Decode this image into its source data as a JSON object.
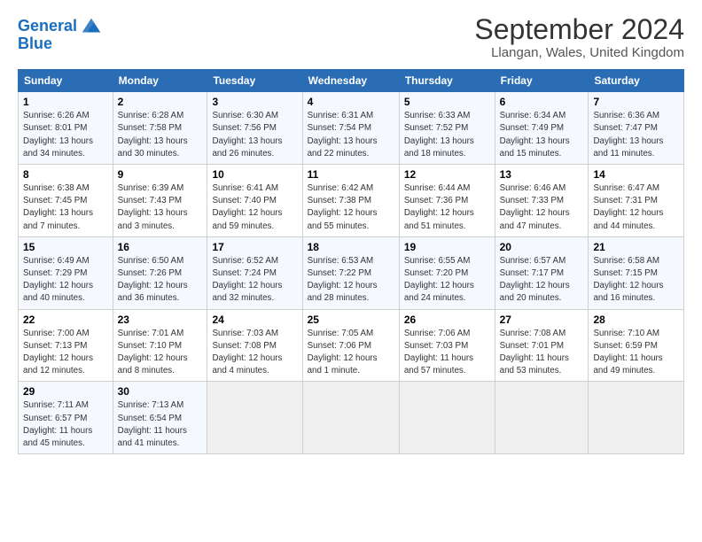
{
  "header": {
    "logo_line1": "General",
    "logo_line2": "Blue",
    "title": "September 2024",
    "subtitle": "Llangan, Wales, United Kingdom"
  },
  "columns": [
    "Sunday",
    "Monday",
    "Tuesday",
    "Wednesday",
    "Thursday",
    "Friday",
    "Saturday"
  ],
  "rows": [
    [
      {
        "day": "1",
        "lines": [
          "Sunrise: 6:26 AM",
          "Sunset: 8:01 PM",
          "Daylight: 13 hours",
          "and 34 minutes."
        ]
      },
      {
        "day": "2",
        "lines": [
          "Sunrise: 6:28 AM",
          "Sunset: 7:58 PM",
          "Daylight: 13 hours",
          "and 30 minutes."
        ]
      },
      {
        "day": "3",
        "lines": [
          "Sunrise: 6:30 AM",
          "Sunset: 7:56 PM",
          "Daylight: 13 hours",
          "and 26 minutes."
        ]
      },
      {
        "day": "4",
        "lines": [
          "Sunrise: 6:31 AM",
          "Sunset: 7:54 PM",
          "Daylight: 13 hours",
          "and 22 minutes."
        ]
      },
      {
        "day": "5",
        "lines": [
          "Sunrise: 6:33 AM",
          "Sunset: 7:52 PM",
          "Daylight: 13 hours",
          "and 18 minutes."
        ]
      },
      {
        "day": "6",
        "lines": [
          "Sunrise: 6:34 AM",
          "Sunset: 7:49 PM",
          "Daylight: 13 hours",
          "and 15 minutes."
        ]
      },
      {
        "day": "7",
        "lines": [
          "Sunrise: 6:36 AM",
          "Sunset: 7:47 PM",
          "Daylight: 13 hours",
          "and 11 minutes."
        ]
      }
    ],
    [
      {
        "day": "8",
        "lines": [
          "Sunrise: 6:38 AM",
          "Sunset: 7:45 PM",
          "Daylight: 13 hours",
          "and 7 minutes."
        ]
      },
      {
        "day": "9",
        "lines": [
          "Sunrise: 6:39 AM",
          "Sunset: 7:43 PM",
          "Daylight: 13 hours",
          "and 3 minutes."
        ]
      },
      {
        "day": "10",
        "lines": [
          "Sunrise: 6:41 AM",
          "Sunset: 7:40 PM",
          "Daylight: 12 hours",
          "and 59 minutes."
        ]
      },
      {
        "day": "11",
        "lines": [
          "Sunrise: 6:42 AM",
          "Sunset: 7:38 PM",
          "Daylight: 12 hours",
          "and 55 minutes."
        ]
      },
      {
        "day": "12",
        "lines": [
          "Sunrise: 6:44 AM",
          "Sunset: 7:36 PM",
          "Daylight: 12 hours",
          "and 51 minutes."
        ]
      },
      {
        "day": "13",
        "lines": [
          "Sunrise: 6:46 AM",
          "Sunset: 7:33 PM",
          "Daylight: 12 hours",
          "and 47 minutes."
        ]
      },
      {
        "day": "14",
        "lines": [
          "Sunrise: 6:47 AM",
          "Sunset: 7:31 PM",
          "Daylight: 12 hours",
          "and 44 minutes."
        ]
      }
    ],
    [
      {
        "day": "15",
        "lines": [
          "Sunrise: 6:49 AM",
          "Sunset: 7:29 PM",
          "Daylight: 12 hours",
          "and 40 minutes."
        ]
      },
      {
        "day": "16",
        "lines": [
          "Sunrise: 6:50 AM",
          "Sunset: 7:26 PM",
          "Daylight: 12 hours",
          "and 36 minutes."
        ]
      },
      {
        "day": "17",
        "lines": [
          "Sunrise: 6:52 AM",
          "Sunset: 7:24 PM",
          "Daylight: 12 hours",
          "and 32 minutes."
        ]
      },
      {
        "day": "18",
        "lines": [
          "Sunrise: 6:53 AM",
          "Sunset: 7:22 PM",
          "Daylight: 12 hours",
          "and 28 minutes."
        ]
      },
      {
        "day": "19",
        "lines": [
          "Sunrise: 6:55 AM",
          "Sunset: 7:20 PM",
          "Daylight: 12 hours",
          "and 24 minutes."
        ]
      },
      {
        "day": "20",
        "lines": [
          "Sunrise: 6:57 AM",
          "Sunset: 7:17 PM",
          "Daylight: 12 hours",
          "and 20 minutes."
        ]
      },
      {
        "day": "21",
        "lines": [
          "Sunrise: 6:58 AM",
          "Sunset: 7:15 PM",
          "Daylight: 12 hours",
          "and 16 minutes."
        ]
      }
    ],
    [
      {
        "day": "22",
        "lines": [
          "Sunrise: 7:00 AM",
          "Sunset: 7:13 PM",
          "Daylight: 12 hours",
          "and 12 minutes."
        ]
      },
      {
        "day": "23",
        "lines": [
          "Sunrise: 7:01 AM",
          "Sunset: 7:10 PM",
          "Daylight: 12 hours",
          "and 8 minutes."
        ]
      },
      {
        "day": "24",
        "lines": [
          "Sunrise: 7:03 AM",
          "Sunset: 7:08 PM",
          "Daylight: 12 hours",
          "and 4 minutes."
        ]
      },
      {
        "day": "25",
        "lines": [
          "Sunrise: 7:05 AM",
          "Sunset: 7:06 PM",
          "Daylight: 12 hours",
          "and 1 minute."
        ]
      },
      {
        "day": "26",
        "lines": [
          "Sunrise: 7:06 AM",
          "Sunset: 7:03 PM",
          "Daylight: 11 hours",
          "and 57 minutes."
        ]
      },
      {
        "day": "27",
        "lines": [
          "Sunrise: 7:08 AM",
          "Sunset: 7:01 PM",
          "Daylight: 11 hours",
          "and 53 minutes."
        ]
      },
      {
        "day": "28",
        "lines": [
          "Sunrise: 7:10 AM",
          "Sunset: 6:59 PM",
          "Daylight: 11 hours",
          "and 49 minutes."
        ]
      }
    ],
    [
      {
        "day": "29",
        "lines": [
          "Sunrise: 7:11 AM",
          "Sunset: 6:57 PM",
          "Daylight: 11 hours",
          "and 45 minutes."
        ]
      },
      {
        "day": "30",
        "lines": [
          "Sunrise: 7:13 AM",
          "Sunset: 6:54 PM",
          "Daylight: 11 hours",
          "and 41 minutes."
        ]
      },
      null,
      null,
      null,
      null,
      null
    ]
  ]
}
